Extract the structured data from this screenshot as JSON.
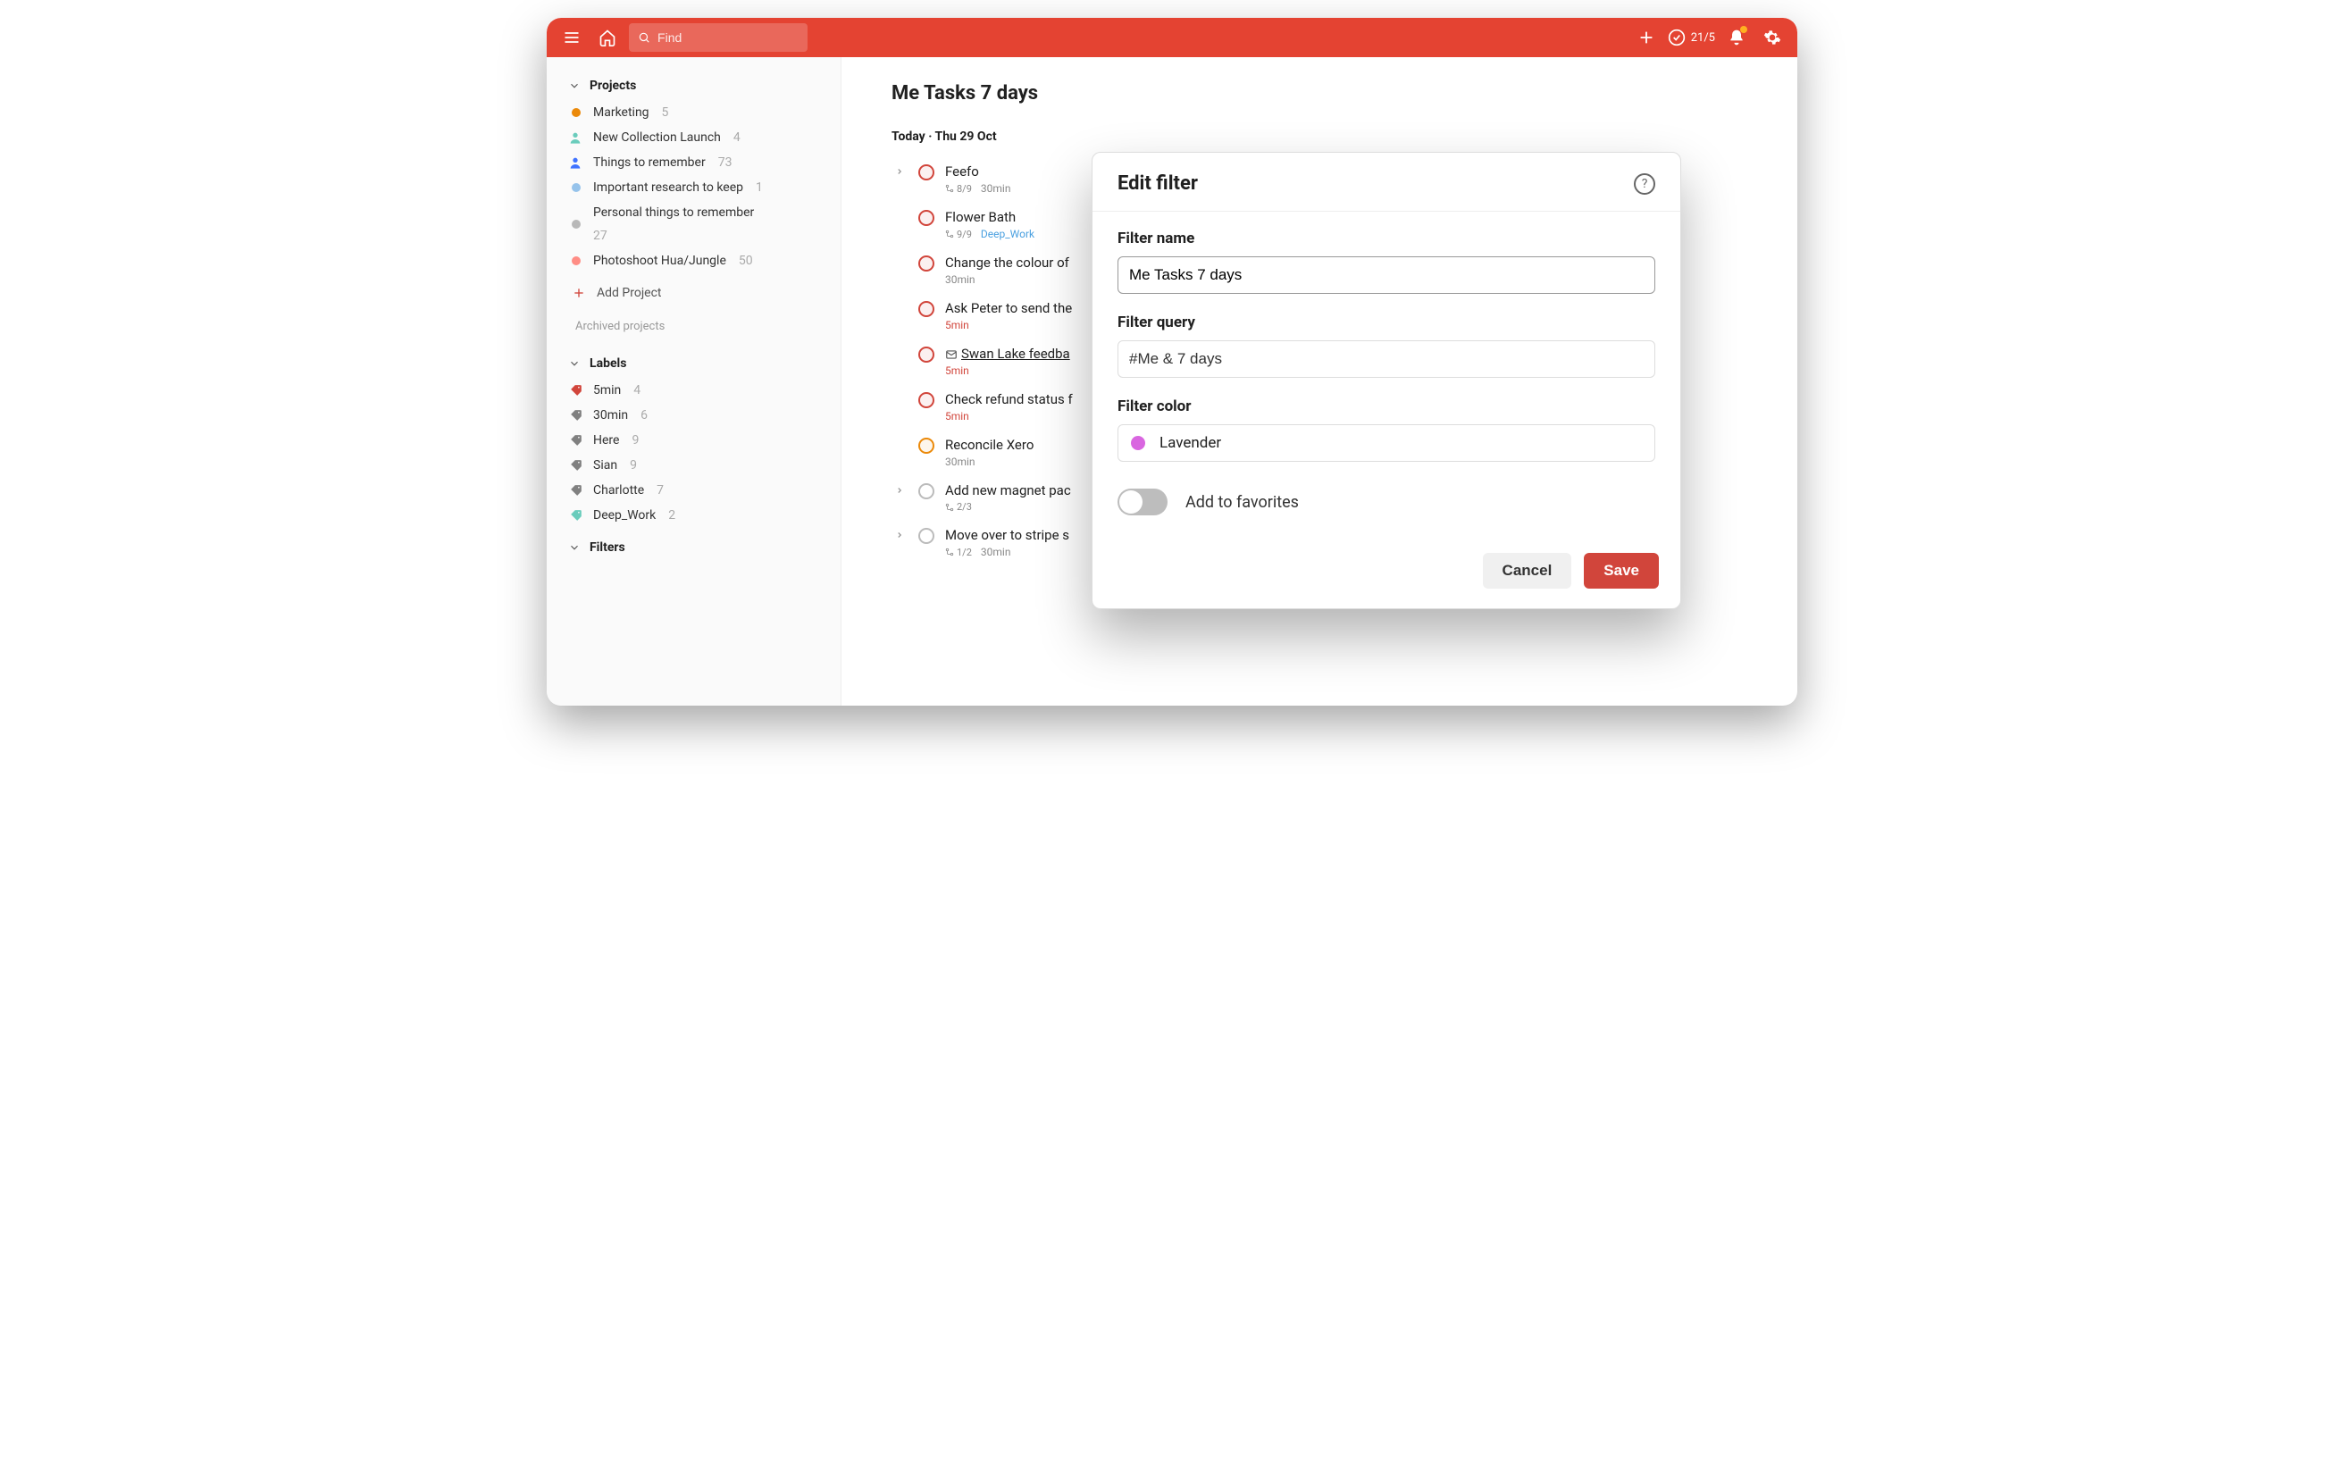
{
  "topbar": {
    "search_placeholder": "Find",
    "productivity_count": "21/5"
  },
  "sidebar": {
    "projects_header": "Projects",
    "projects": [
      {
        "name": "Marketing",
        "count": "5",
        "color": "#eb8909"
      },
      {
        "name": "New Collection Launch",
        "count": "4",
        "color": "#6accbc",
        "person": true
      },
      {
        "name": "Things to remember",
        "count": "73",
        "color": "#4073ff",
        "person": true
      },
      {
        "name": "Important research to keep",
        "count": "1",
        "color": "#96c3eb"
      },
      {
        "name": "Personal things to remember",
        "count": "27",
        "color": "#b8b8b8"
      },
      {
        "name": "Photoshoot Hua/Jungle",
        "count": "50",
        "color": "#ff8d85"
      }
    ],
    "add_project": "Add Project",
    "archived": "Archived projects",
    "labels_header": "Labels",
    "labels": [
      {
        "name": "5min",
        "count": "4",
        "color": "#d1453b"
      },
      {
        "name": "30min",
        "count": "6",
        "color": "#808080"
      },
      {
        "name": "Here",
        "count": "9",
        "color": "#808080"
      },
      {
        "name": "Sian",
        "count": "9",
        "color": "#808080"
      },
      {
        "name": "Charlotte",
        "count": "7",
        "color": "#808080"
      },
      {
        "name": "Deep_Work",
        "count": "2",
        "color": "#6accbc"
      }
    ],
    "filters_header": "Filters"
  },
  "main": {
    "title": "Me Tasks 7 days",
    "date_header": "Today · Thu 29 Oct",
    "tasks": [
      {
        "title": "Feefo",
        "priority": "red",
        "expand": true,
        "sub": "8/9",
        "meta1": "30min"
      },
      {
        "title": "Flower Bath",
        "priority": "red",
        "sub": "9/9",
        "meta1_blue": "Deep_Work"
      },
      {
        "title": "Change the colour of",
        "priority": "red",
        "meta1": "30min"
      },
      {
        "title": "Ask Peter to send the",
        "priority": "red",
        "meta1_red": "5min"
      },
      {
        "title": "Swan Lake feedba",
        "priority": "red",
        "underline": true,
        "mail": true,
        "meta1_red": "5min"
      },
      {
        "title": "Check refund status f",
        "priority": "red",
        "meta1_red": "5min"
      },
      {
        "title": "Reconcile Xero",
        "priority": "orange",
        "meta1": "30min"
      },
      {
        "title": "Add new magnet pac",
        "priority": "gray",
        "expand": true,
        "sub": "2/3"
      },
      {
        "title": "Move over to stripe s",
        "priority": "gray",
        "expand": true,
        "sub": "1/2",
        "meta1": "30min"
      }
    ]
  },
  "modal": {
    "title": "Edit filter",
    "name_label": "Filter name",
    "name_value": "Me Tasks 7 days",
    "query_label": "Filter query",
    "query_value": "#Me & 7 days",
    "color_label": "Filter color",
    "color_value": "Lavender",
    "color_hex": "#d966e0",
    "favorites_label": "Add to favorites",
    "cancel": "Cancel",
    "save": "Save"
  }
}
